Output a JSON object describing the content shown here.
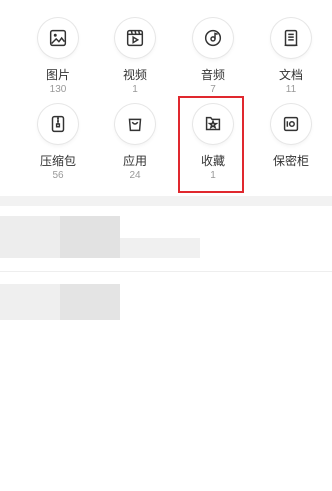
{
  "categories": [
    {
      "id": "images",
      "label": "图片",
      "count": "130",
      "icon": "image-icon"
    },
    {
      "id": "videos",
      "label": "视频",
      "count": "1",
      "icon": "video-icon"
    },
    {
      "id": "audio",
      "label": "音频",
      "count": "7",
      "icon": "music-disc-icon"
    },
    {
      "id": "docs",
      "label": "文档",
      "count": "11",
      "icon": "document-icon"
    },
    {
      "id": "archives",
      "label": "压缩包",
      "count": "56",
      "icon": "zip-icon"
    },
    {
      "id": "apps",
      "label": "应用",
      "count": "24",
      "icon": "bag-icon"
    },
    {
      "id": "favorites",
      "label": "收藏",
      "count": "1",
      "icon": "star-folder-icon"
    },
    {
      "id": "safe",
      "label": "保密柜",
      "count": "",
      "icon": "safe-icon"
    }
  ],
  "colors": {
    "highlight": "#e0282e",
    "icon": "#333333",
    "label": "#333333",
    "count": "#999999"
  }
}
